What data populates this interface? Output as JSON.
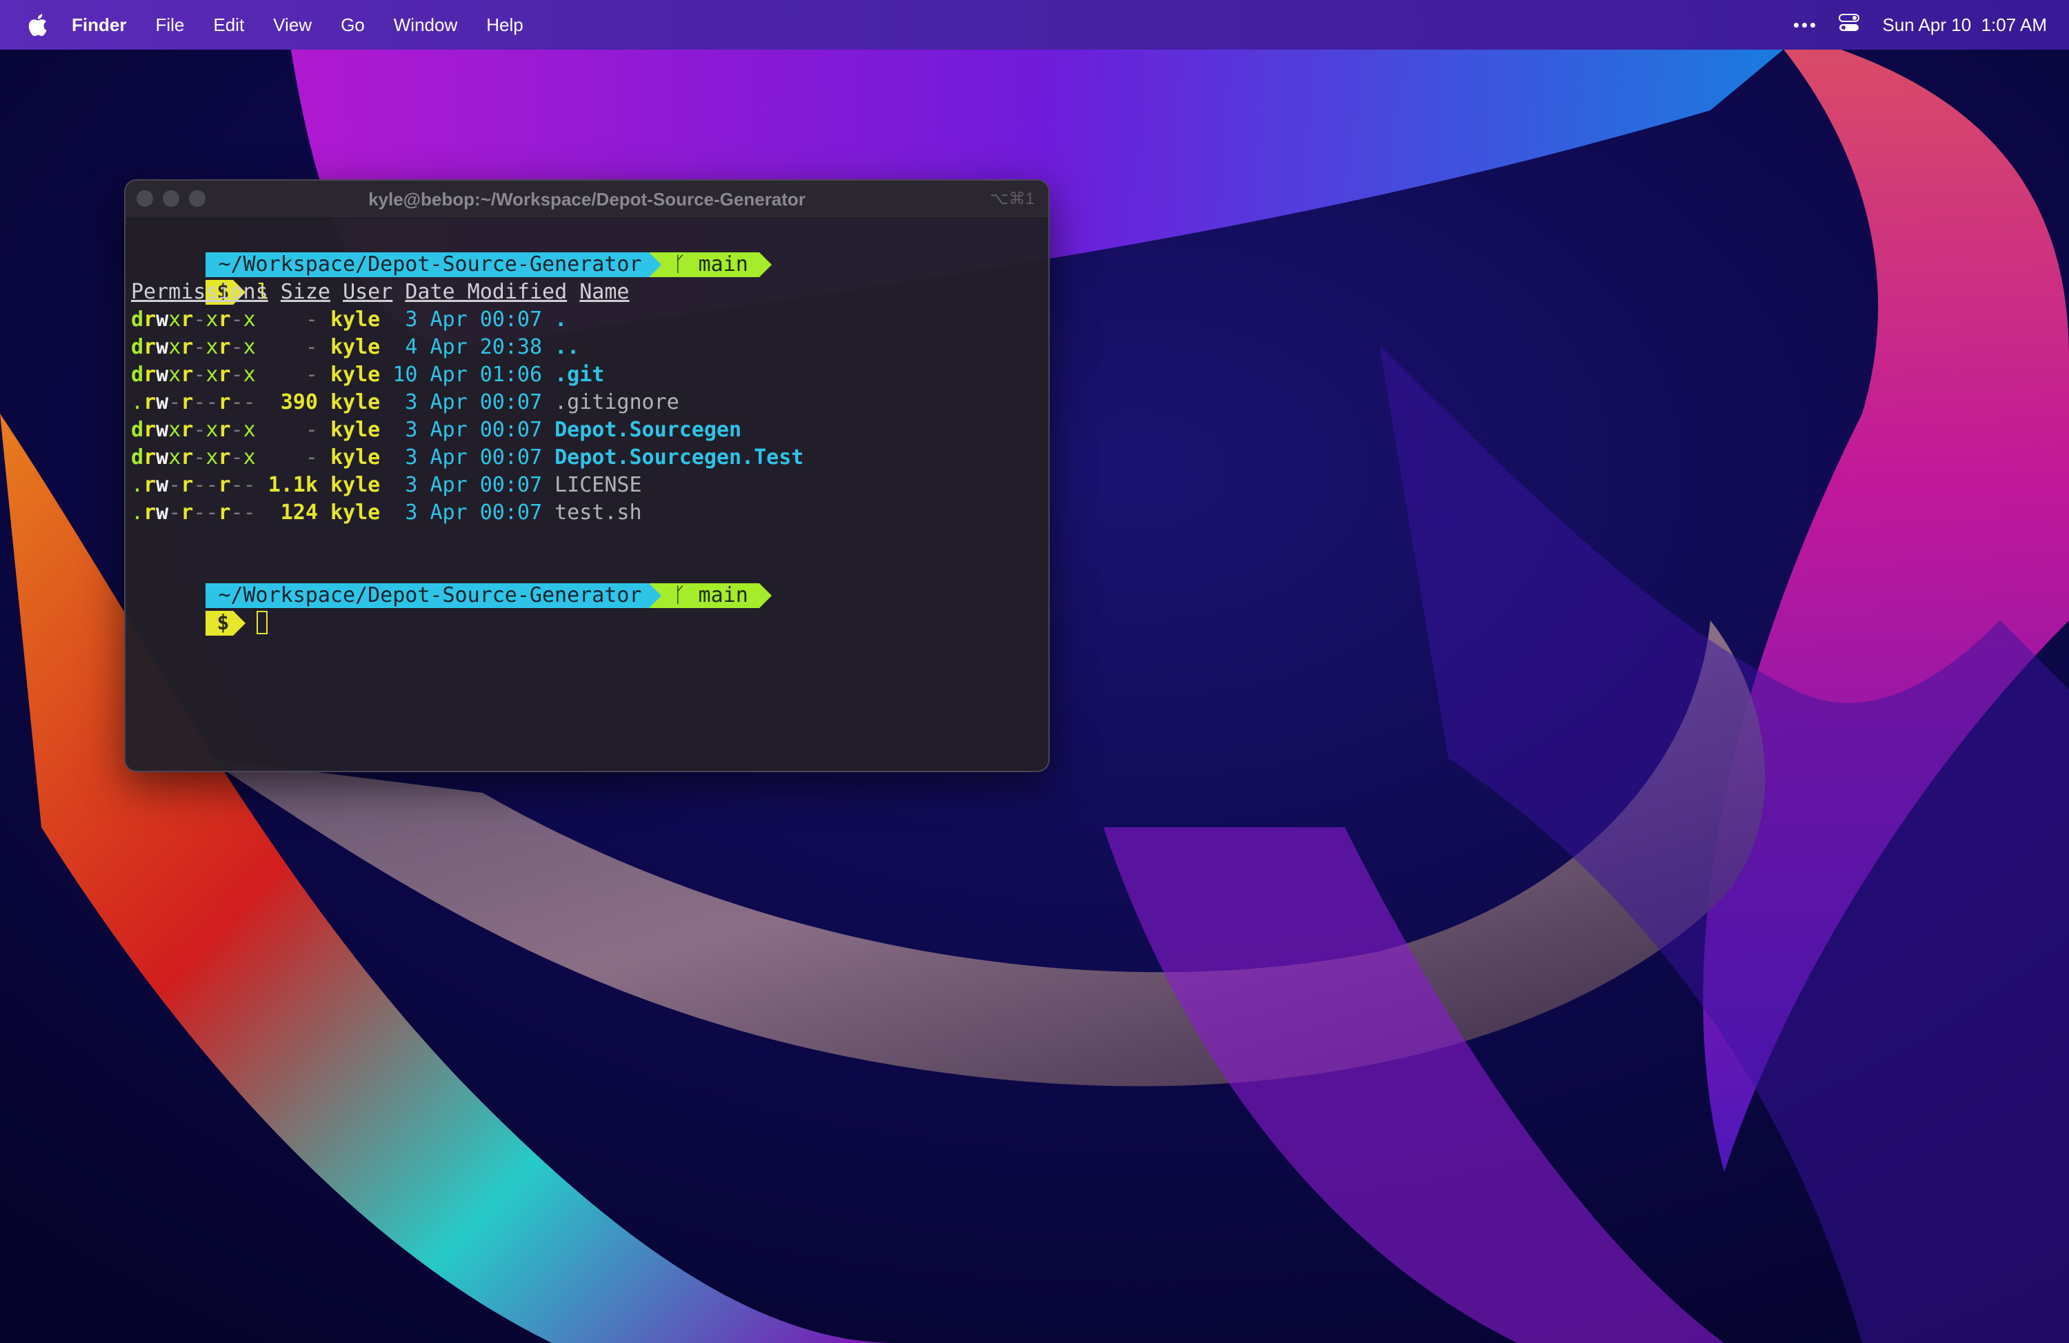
{
  "menubar": {
    "apple_icon": "apple-icon",
    "app_name": "Finder",
    "items": [
      "File",
      "Edit",
      "View",
      "Go",
      "Window",
      "Help"
    ],
    "status": {
      "more_icon": "ellipsis-icon",
      "control_center_icon": "control-center-icon",
      "datetime": "Sun Apr 10  1:07 AM"
    }
  },
  "terminal": {
    "title": "kyle@bebop:~/Workspace/Depot-Source-Generator",
    "shortcut": "⌥⌘1",
    "prompt": {
      "path": "~/Workspace/Depot-Source-Generator",
      "branch": "main",
      "branch_icon": "git-branch-icon",
      "symbol": "$"
    },
    "command": "l",
    "headers": {
      "permissions": "Permissions",
      "size": "Size",
      "user": "User",
      "date": "Date Modified",
      "name": "Name"
    },
    "rows": [
      {
        "perm_type": "d",
        "perm": "rwxr-xr-x",
        "size": "-",
        "user": "kyle",
        "date": " 3 Apr 00:07",
        "name": ".",
        "kind": "dir"
      },
      {
        "perm_type": "d",
        "perm": "rwxr-xr-x",
        "size": "-",
        "user": "kyle",
        "date": " 4 Apr 20:38",
        "name": "..",
        "kind": "dir"
      },
      {
        "perm_type": "d",
        "perm": "rwxr-xr-x",
        "size": "-",
        "user": "kyle",
        "date": "10 Apr 01:06",
        "name": ".git",
        "kind": "dir"
      },
      {
        "perm_type": ".",
        "perm": "rw-r--r--",
        "size": "390",
        "user": "kyle",
        "date": " 3 Apr 00:07",
        "name": ".gitignore",
        "kind": "file"
      },
      {
        "perm_type": "d",
        "perm": "rwxr-xr-x",
        "size": "-",
        "user": "kyle",
        "date": " 3 Apr 00:07",
        "name": "Depot.Sourcegen",
        "kind": "dir"
      },
      {
        "perm_type": "d",
        "perm": "rwxr-xr-x",
        "size": "-",
        "user": "kyle",
        "date": " 3 Apr 00:07",
        "name": "Depot.Sourcegen.Test",
        "kind": "dir"
      },
      {
        "perm_type": ".",
        "perm": "rw-r--r--",
        "size": "1.1k",
        "user": "kyle",
        "date": " 3 Apr 00:07",
        "name": "LICENSE",
        "kind": "file"
      },
      {
        "perm_type": ".",
        "perm": "rw-r--r--",
        "size": "124",
        "user": "kyle",
        "date": " 3 Apr 00:07",
        "name": "test.sh",
        "kind": "file"
      }
    ]
  },
  "colors": {
    "prompt_path_bg": "#2ec4e8",
    "prompt_branch_bg": "#a5ec2a",
    "prompt_symbol_bg": "#e6e62c",
    "menubar_bg": "#4a23a6"
  }
}
